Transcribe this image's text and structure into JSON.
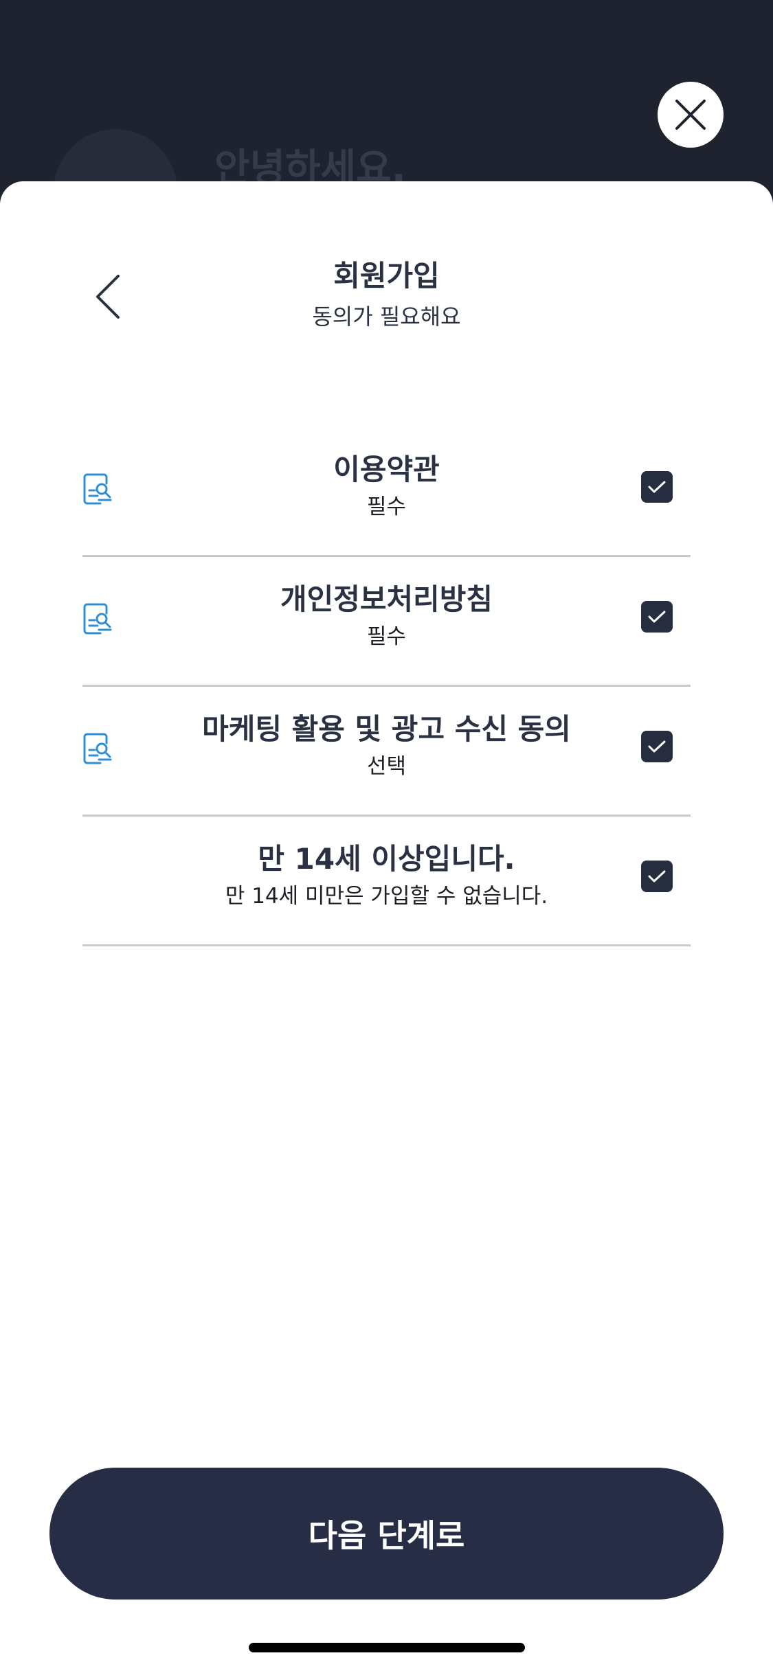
{
  "background": {
    "greeting": "안녕하세요."
  },
  "header": {
    "title": "회원가입",
    "subtitle": "동의가 필요해요",
    "back_icon": "chevron-left-icon",
    "close_icon": "close-icon"
  },
  "agreements": [
    {
      "title": "이용약관",
      "subtitle": "필수",
      "has_doc_icon": true,
      "checked": true
    },
    {
      "title": "개인정보처리방침",
      "subtitle": "필수",
      "has_doc_icon": true,
      "checked": true
    },
    {
      "title": "마케팅 활용 및 광고 수신 동의",
      "subtitle": "선택",
      "has_doc_icon": true,
      "checked": true
    },
    {
      "title": "만 14세 이상입니다.",
      "subtitle": "만 14세 미만은 가입할 수 없습니다.",
      "has_doc_icon": false,
      "checked": true
    }
  ],
  "footer": {
    "next_label": "다음 단계로"
  },
  "colors": {
    "dark_navy": "#1e232f",
    "button_navy": "#262d45",
    "icon_blue": "#2f8fd6",
    "divider": "#c9cbd0"
  }
}
